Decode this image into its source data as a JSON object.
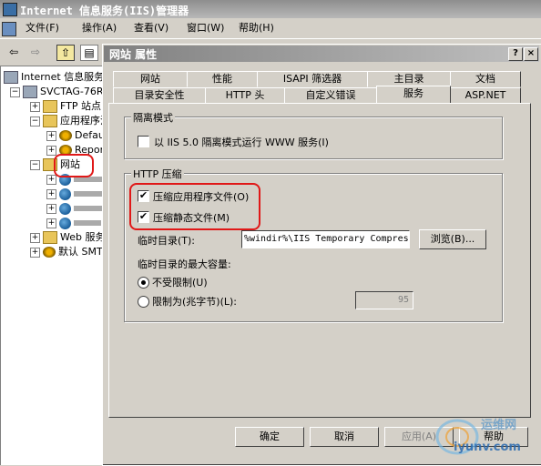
{
  "app": {
    "title": "Internet 信息服务(IIS)管理器",
    "menu": [
      "文件(F)",
      "操作(A)",
      "查看(V)",
      "窗口(W)",
      "帮助(H)"
    ]
  },
  "tree": {
    "items": [
      {
        "label": "Internet 信息服务"
      },
      {
        "label": "SVCTAG-76RY"
      },
      {
        "label": "FTP 站点"
      },
      {
        "label": "应用程序池"
      },
      {
        "label": "Defau"
      },
      {
        "label": "Repor"
      },
      {
        "label": "网站"
      },
      {
        "label": ""
      },
      {
        "label": ""
      },
      {
        "label": ""
      },
      {
        "label": ""
      },
      {
        "label": "Web 服务"
      },
      {
        "label": "默认 SMT"
      }
    ]
  },
  "dialog": {
    "title": "网站 属性",
    "help_btn": "?",
    "close_btn": "×",
    "tabs_row1": [
      "网站",
      "性能",
      "ISAPI 筛选器",
      "主目录",
      "文档"
    ],
    "tabs_row2": [
      "目录安全性",
      "HTTP 头",
      "自定义错误",
      "服务",
      "ASP.NET"
    ],
    "active_tab": "服务",
    "isolation": {
      "legend": "隔离模式",
      "checkbox_label": "以 IIS 5.0 隔离模式运行 WWW 服务(I)",
      "checked": false
    },
    "compression": {
      "legend": "HTTP 压缩",
      "app_files_label": "压缩应用程序文件(O)",
      "app_files_checked": true,
      "static_files_label": "压缩静态文件(M)",
      "static_files_checked": true,
      "temp_dir_label": "临时目录(T):",
      "temp_dir_value": "%windir%\\IIS Temporary Compres",
      "browse_label": "浏览(B)...",
      "max_size_label": "临时目录的最大容量:",
      "unlimited_label": "不受限制(U)",
      "limit_label": "限制为(兆字节)(L):",
      "limit_value": "95",
      "selected": "unlimited"
    },
    "buttons": {
      "ok": "确定",
      "cancel": "取消",
      "apply": "应用(A)",
      "help": "帮助"
    }
  },
  "watermark": {
    "text1": "运维网",
    "text2": "iyunv.com"
  },
  "colors": {
    "highlight": "#e01818"
  }
}
